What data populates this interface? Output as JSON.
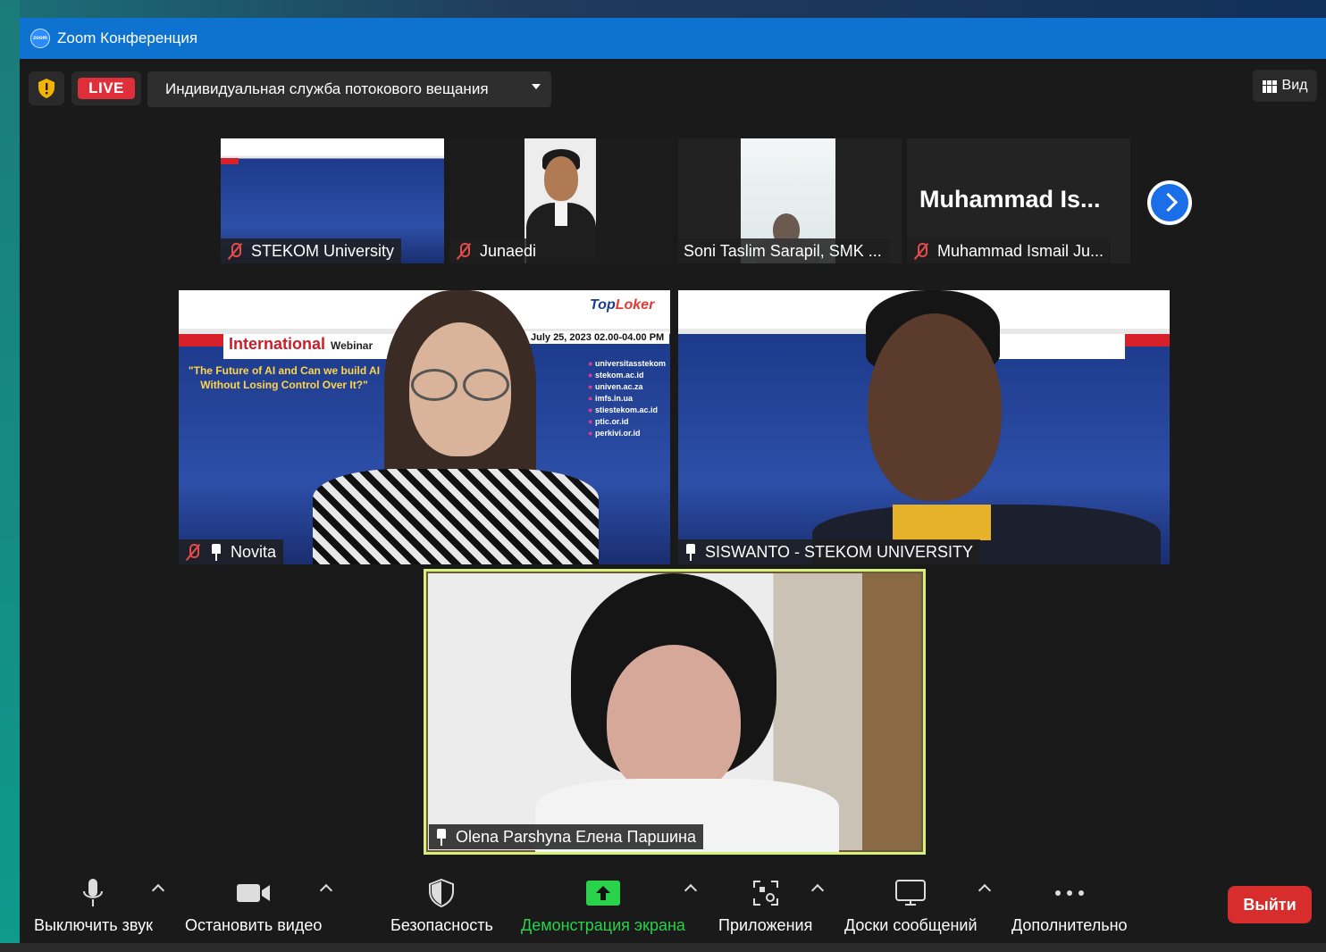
{
  "window": {
    "title": "Zoom Конференция"
  },
  "topbar": {
    "live_label": "LIVE",
    "stream_label": "Индивидуальная служба потокового вещания",
    "view_label": "Вид"
  },
  "thumbnails": [
    {
      "name": "STEKOM University",
      "muted": true
    },
    {
      "name": "Junaedi",
      "muted": true
    },
    {
      "name": "Soni Taslim Sarapil, SMK ...",
      "muted": false
    },
    {
      "name": "Muhammad Ismail Ju...",
      "muted": true,
      "display_name": "Muhammad  Is..."
    }
  ],
  "main_tiles": [
    {
      "name": "Novita",
      "muted": true,
      "pinned": true
    },
    {
      "name": "SISWANTO - STEKOM UNIVERSITY",
      "muted": false,
      "pinned": true
    },
    {
      "name": "Olena Parshyna Елена Паршина",
      "muted": false,
      "pinned": true,
      "active_speaker": true
    }
  ],
  "slide": {
    "title": "International",
    "title_suffix": "Webinar",
    "quote": "\"The Future of AI and Can we build AI Without Losing Control Over It?\"",
    "date": "July 25, 2023 02.00-04.00 PM",
    "brand": "TopLoker",
    "links": [
      "universitasstekom",
      "stekom.ac.id",
      "univen.ac.za",
      "imfs.in.ua",
      "stiestekom.ac.id",
      "ptic.or.id",
      "perkivi.or.id"
    ]
  },
  "toolbar": {
    "mute_label": "Выключить звук",
    "video_label": "Остановить видео",
    "security_label": "Безопасность",
    "share_label": "Демонстрация экрана",
    "apps_label": "Приложения",
    "whiteboard_label": "Доски сообщений",
    "more_label": "Дополнительно",
    "leave_label": "Выйти"
  },
  "colors": {
    "titlebar": "#0e72d0",
    "live": "#e02f3b",
    "share_green": "#2ad14a",
    "active_speaker_border": "#d8f07a",
    "leave": "#d72d2d"
  }
}
